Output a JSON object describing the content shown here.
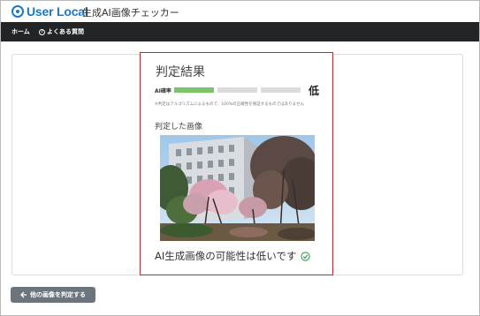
{
  "brand": {
    "logo_text": "User Local",
    "app_title": "生成AI画像チェッカー"
  },
  "nav": {
    "home": "ホーム",
    "faq": "よくある質問",
    "faq_icon": "question-circle-icon"
  },
  "result": {
    "title": "判定結果",
    "probability_label": "AI確率",
    "probability_level": "低",
    "bars": {
      "filled": 1,
      "total": 3,
      "fill_color": "#7ac46a",
      "empty_color": "#dcdcdc"
    },
    "note": "※判定はアルゴリズムによるもので、100%の正確性を保証するものではありません",
    "image_heading": "判定した画像",
    "verdict": "AI生成画像の可能性は低いです",
    "verdict_icon": "check-circle-icon"
  },
  "actions": {
    "back_label": "他の画像を判定する",
    "back_icon": "arrow-left-icon"
  },
  "colors": {
    "accent": "#1a78c8",
    "navbar": "#222426",
    "highlight_border": "#c0262c",
    "success": "#2e9d4e",
    "button": "#6c757d"
  }
}
